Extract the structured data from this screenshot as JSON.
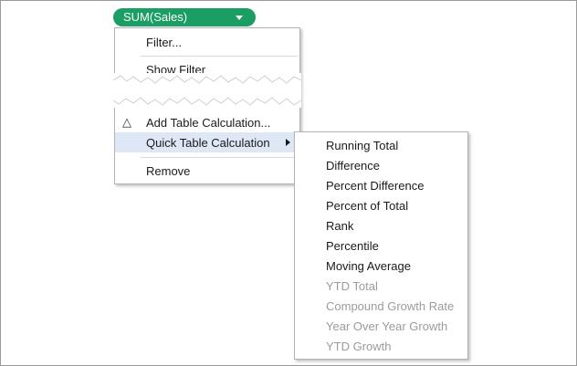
{
  "pill": {
    "label": "SUM(Sales)",
    "color": "#1a9e63"
  },
  "context_menu": {
    "items_top": [
      {
        "label": "Filter..."
      },
      {
        "label": "Show Filter"
      }
    ],
    "items_bottom": [
      {
        "label": "Add Table Calculation...",
        "icon": "delta-icon"
      },
      {
        "label": "Quick Table Calculation",
        "has_submenu": true,
        "highlighted": true
      },
      {
        "label": "Remove"
      }
    ]
  },
  "submenu": {
    "items": [
      {
        "label": "Running Total",
        "enabled": true
      },
      {
        "label": "Difference",
        "enabled": true
      },
      {
        "label": "Percent Difference",
        "enabled": true
      },
      {
        "label": "Percent of Total",
        "enabled": true
      },
      {
        "label": "Rank",
        "enabled": true
      },
      {
        "label": "Percentile",
        "enabled": true
      },
      {
        "label": "Moving Average",
        "enabled": true
      },
      {
        "label": "YTD Total",
        "enabled": false
      },
      {
        "label": "Compound Growth Rate",
        "enabled": false
      },
      {
        "label": "Year Over Year Growth",
        "enabled": false
      },
      {
        "label": "YTD Growth",
        "enabled": false
      }
    ]
  },
  "colors": {
    "highlight": "#dde7f5",
    "disabled_text": "#9b9b9b"
  }
}
